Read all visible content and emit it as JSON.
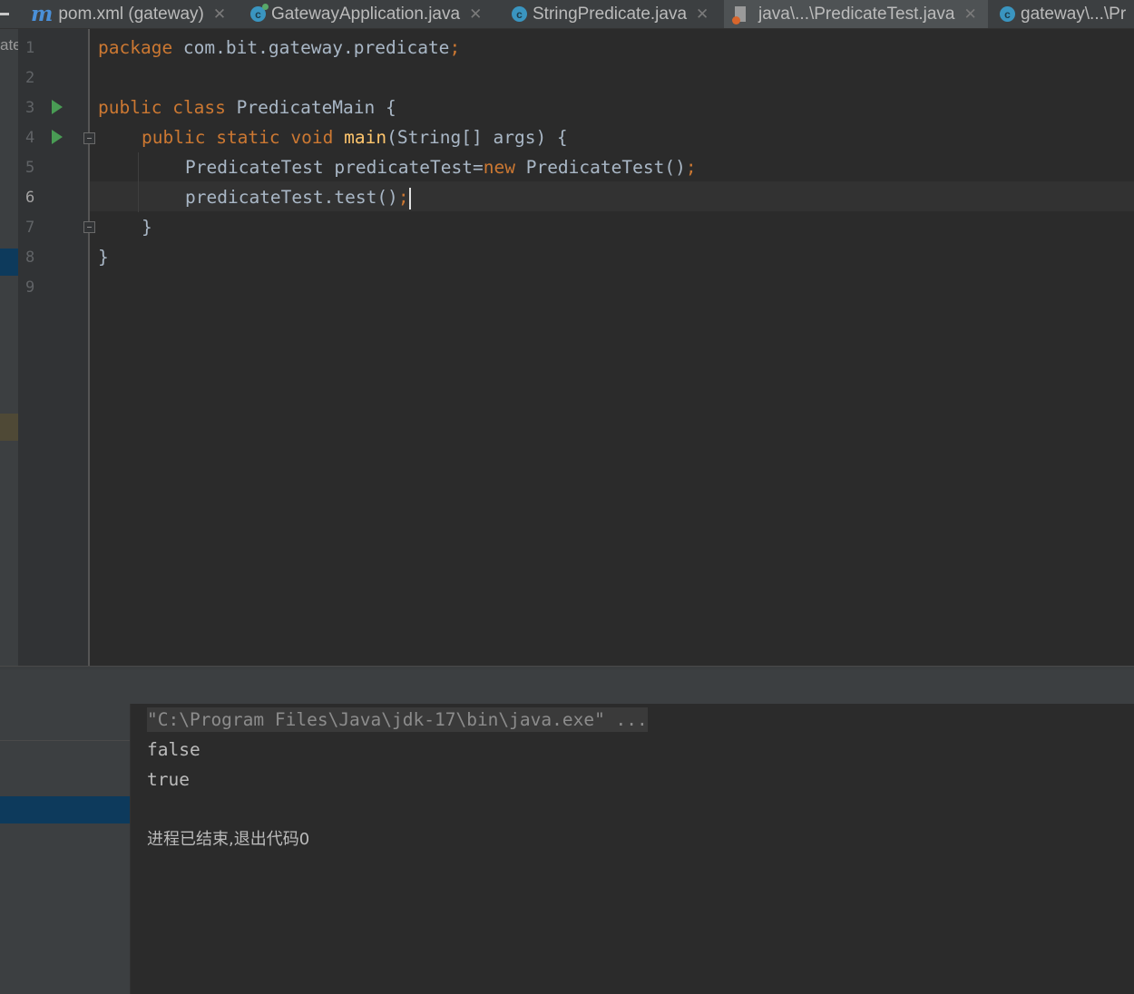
{
  "tabs": [
    {
      "icon": "maven-icon",
      "label": "pom.xml (gateway)",
      "active": false
    },
    {
      "icon": "spring-class-icon",
      "label": "GatewayApplication.java",
      "active": false
    },
    {
      "icon": "class-icon",
      "label": "StringPredicate.java",
      "active": false
    },
    {
      "icon": "java-file-icon",
      "label": "java\\...\\PredicateTest.java",
      "active": true
    },
    {
      "icon": "class-icon",
      "label": "gateway\\...\\Pr",
      "active": false
    }
  ],
  "icons": {
    "maven": "m",
    "class": "c"
  },
  "left_strip_text": "ate",
  "line_numbers": [
    "1",
    "2",
    "3",
    "4",
    "5",
    "6",
    "7",
    "8",
    "9"
  ],
  "current_line": 6,
  "code": {
    "l1": {
      "kw": "package",
      "rest": " com.bit.gateway.predicate",
      "semi": ";"
    },
    "l3": {
      "kw1": "public",
      "kw2": "class",
      "rest": " PredicateMain {"
    },
    "l4": {
      "kw1": "public",
      "kw2": "static",
      "kw3": "void",
      "fn": "main",
      "rest": "(String[] args) {"
    },
    "l5": {
      "pre": "PredicateTest predicateTest=",
      "kw": "new",
      "rest": " PredicateTest()",
      "semi": ";"
    },
    "l6": {
      "pre": "predicateTest.test()",
      "semi": ";"
    },
    "l7": "}",
    "l8": "}"
  },
  "console": {
    "command": "\"C:\\Program Files\\Java\\jdk-17\\bin\\java.exe\" ...",
    "output": [
      "false",
      "true"
    ],
    "exit_message": "进程已结束,退出代码0"
  },
  "colors": {
    "keyword": "#cc7832",
    "function": "#ffc66d",
    "text": "#a9b7c6",
    "run": "#499c54"
  }
}
